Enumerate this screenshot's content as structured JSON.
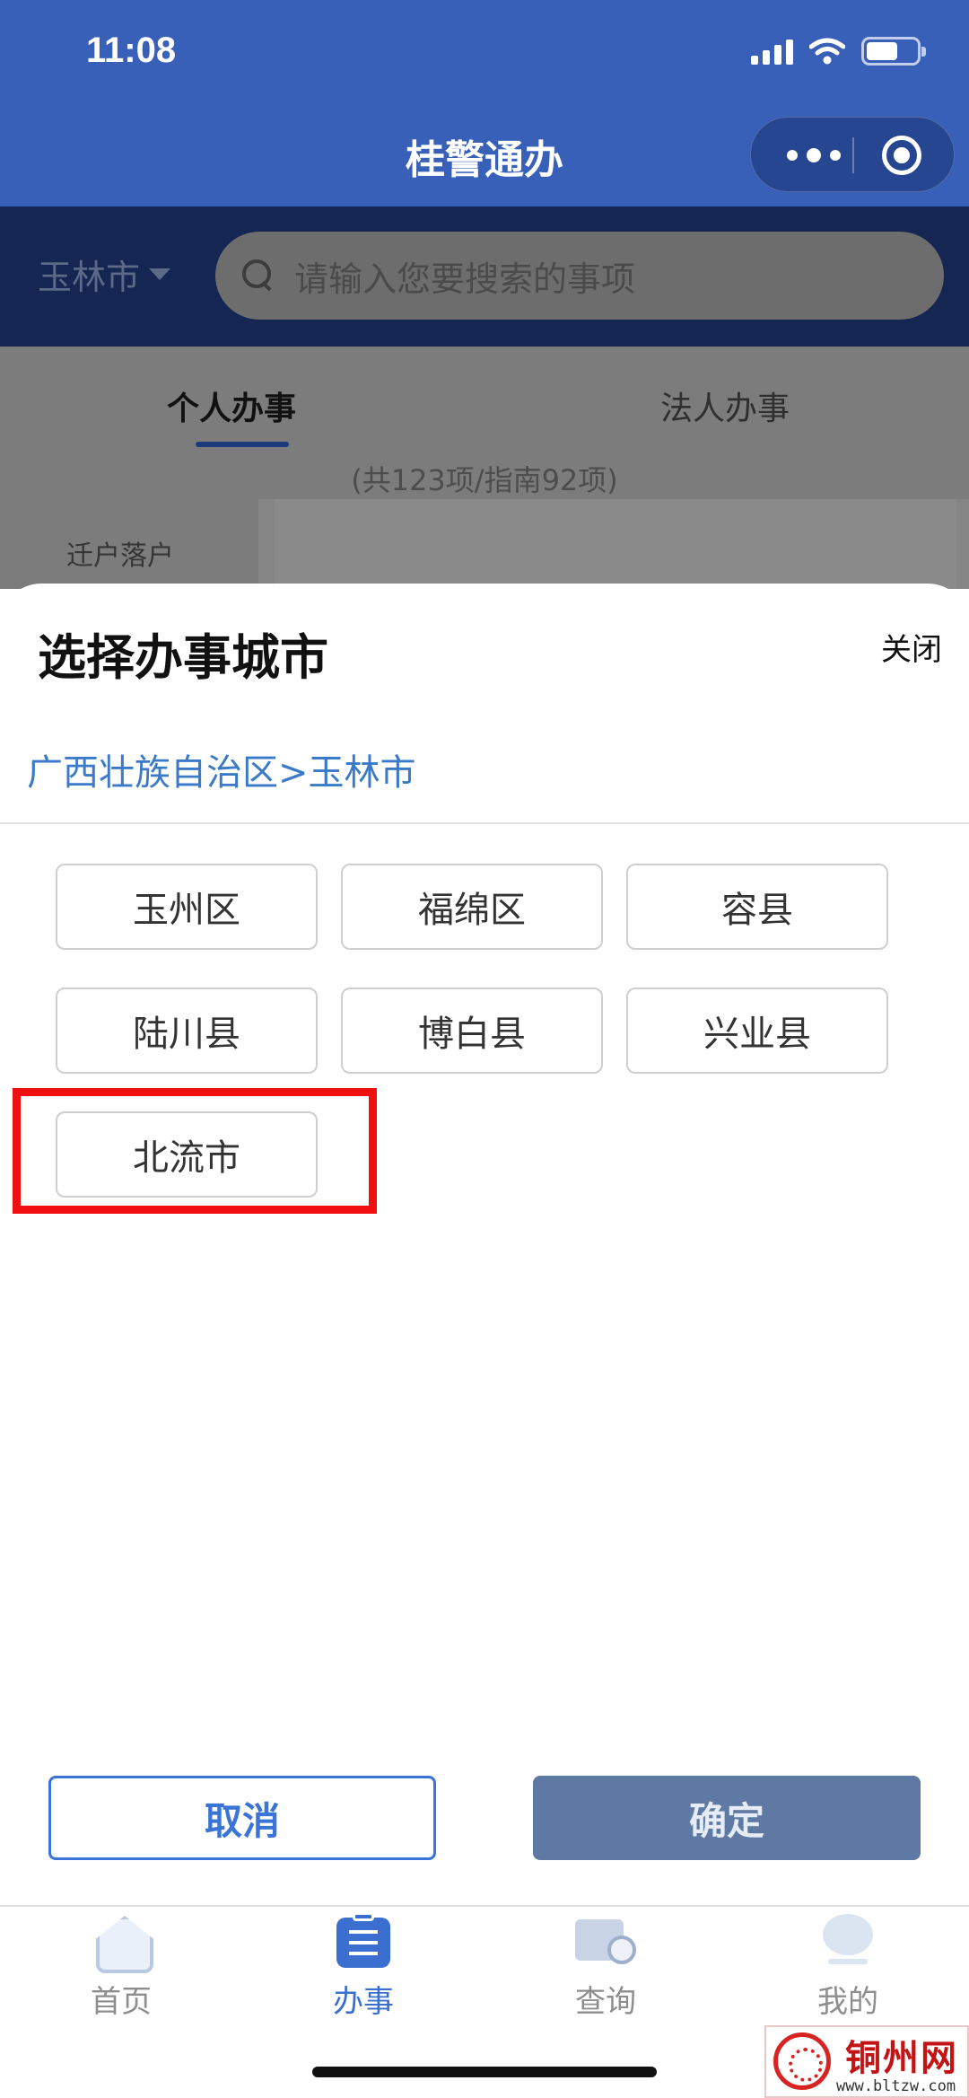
{
  "status_bar": {
    "time": "11:08"
  },
  "app": {
    "title": "桂警通办"
  },
  "search": {
    "city": "玉林市",
    "placeholder": "请输入您要搜索的事项"
  },
  "background_page": {
    "tabs": [
      {
        "label": "个人办事"
      },
      {
        "label": "法人办事"
      }
    ],
    "count_text": "(共123项/指南92项)",
    "sidebar_item": "迁户落户"
  },
  "sheet": {
    "title": "选择办事城市",
    "close_label": "关闭",
    "breadcrumb": "广西壮族自治区>玉林市",
    "options": [
      {
        "label": "玉州区"
      },
      {
        "label": "福绵区"
      },
      {
        "label": "容县"
      },
      {
        "label": "陆川县"
      },
      {
        "label": "博白县"
      },
      {
        "label": "兴业县"
      },
      {
        "label": "北流市"
      }
    ],
    "cancel_label": "取消",
    "confirm_label": "确定"
  },
  "tab_bar": {
    "items": [
      {
        "label": "首页",
        "icon": "home-icon"
      },
      {
        "label": "办事",
        "icon": "clipboard-icon"
      },
      {
        "label": "查询",
        "icon": "query-icon"
      },
      {
        "label": "我的",
        "icon": "me-icon"
      }
    ],
    "active_index": 1
  },
  "watermark": {
    "name": "铜州网",
    "url": "www.bltzw.com"
  },
  "colors": {
    "header_blue": "#3860b8",
    "link_blue": "#3b7ac9",
    "confirm_bg": "#5e7aa4",
    "highlight_red": "#f01010"
  }
}
